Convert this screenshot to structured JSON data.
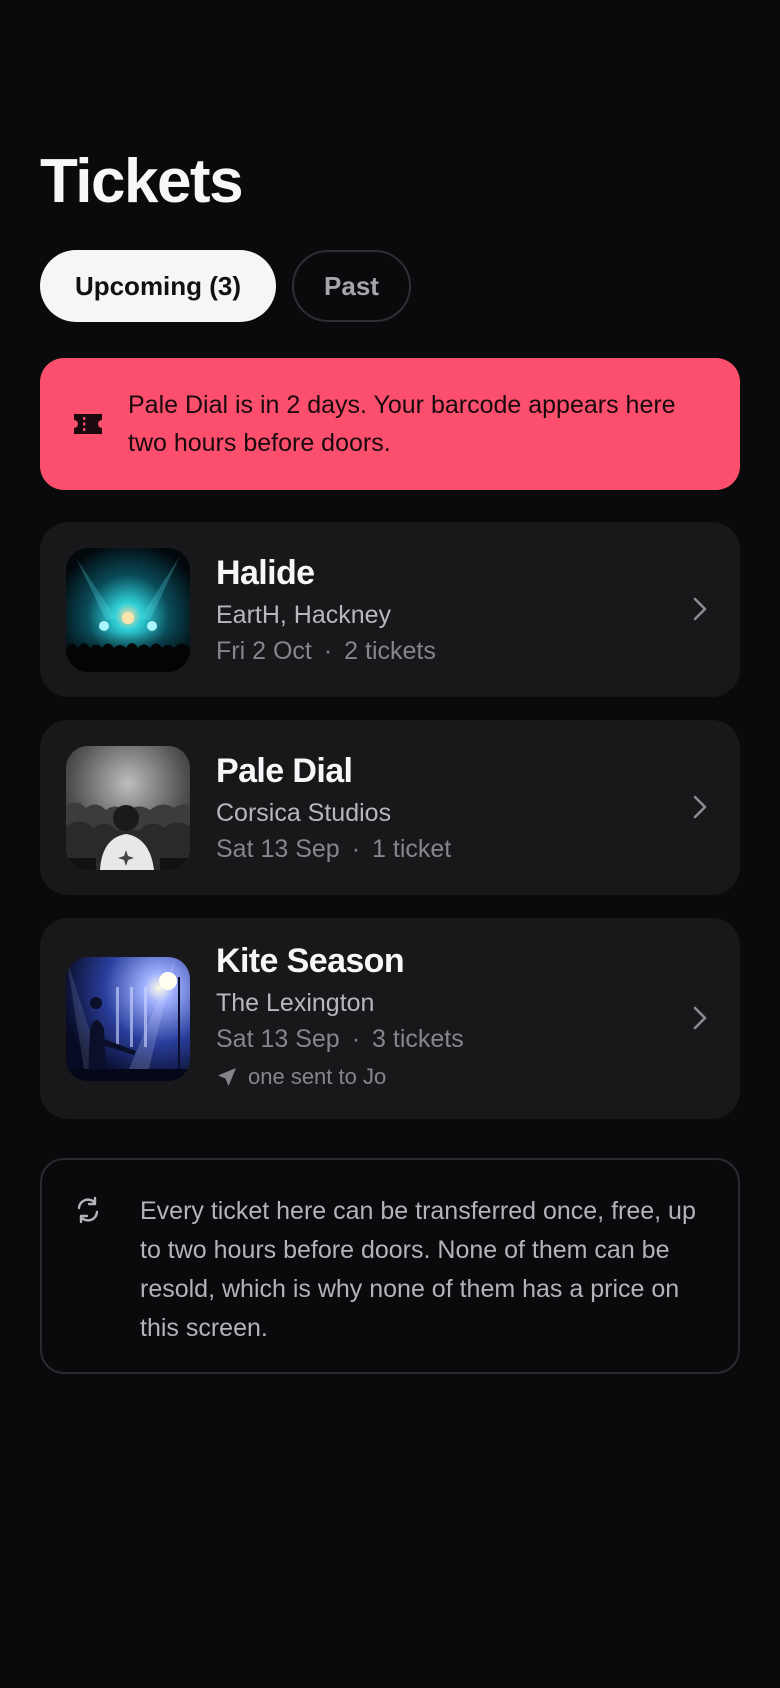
{
  "header": {
    "title": "Tickets"
  },
  "tabs": [
    {
      "label": "Upcoming (3)",
      "active": true
    },
    {
      "label": "Past",
      "active": false
    }
  ],
  "banner": {
    "icon": "ticket-icon",
    "text": "Pale Dial is in 2 days. Your barcode appears here two hours before doors.",
    "background": "#fc4f6e"
  },
  "events": [
    {
      "title": "Halide",
      "venue": "EartH, Hackney",
      "date": "Fri 2 Oct",
      "separator": "·",
      "tickets": "2 tickets",
      "image": "concert-stage-teal-lights"
    },
    {
      "title": "Pale Dial",
      "venue": "Corsica Studios",
      "date": "Sat 13 Sep",
      "separator": "·",
      "tickets": "1 ticket",
      "image": "dj-crowd-monochrome"
    },
    {
      "title": "Kite Season",
      "venue": "The Lexington",
      "date": "Sat 13 Sep",
      "separator": "·",
      "tickets": "3 tickets",
      "sent_note": "one sent to Jo",
      "image": "band-blue-stage-lights"
    }
  ],
  "info": {
    "icon": "refresh-icon",
    "text": "Every ticket here can be transferred once, free, up to two hours before doors. None of them can be resold, which is why none of them has a price on this screen."
  },
  "colors": {
    "background": "#0a0a0c",
    "card": "#18181b",
    "accent": "#fc4f6e"
  }
}
